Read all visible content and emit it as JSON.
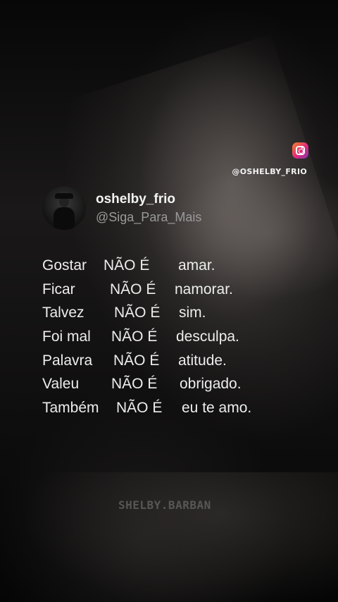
{
  "overlay": {
    "instagram_icon": "instagram-icon",
    "instagram_handle": "@OSHELBY_FRIO"
  },
  "post": {
    "username": "oshelby_frio",
    "handle": "@Siga_Para_Mais",
    "lines": [
      {
        "left": "Gostar",
        "mid": "NÃO É",
        "right": "amar."
      },
      {
        "left": "Ficar",
        "mid": "NÃO É",
        "right": "namorar."
      },
      {
        "left": "Talvez",
        "mid": "NÃO É",
        "right": "sim."
      },
      {
        "left": "Foi mal",
        "mid": "NÃO É",
        "right": "desculpa."
      },
      {
        "left": "Palavra",
        "mid": "NÃO É",
        "right": "atitude."
      },
      {
        "left": "Valeu",
        "mid": "NÃO É",
        "right": "obrigado."
      },
      {
        "left": "Também",
        "mid": "NÃO É",
        "right": "eu te amo."
      }
    ]
  },
  "watermark": "SHELBY.BARBAN"
}
